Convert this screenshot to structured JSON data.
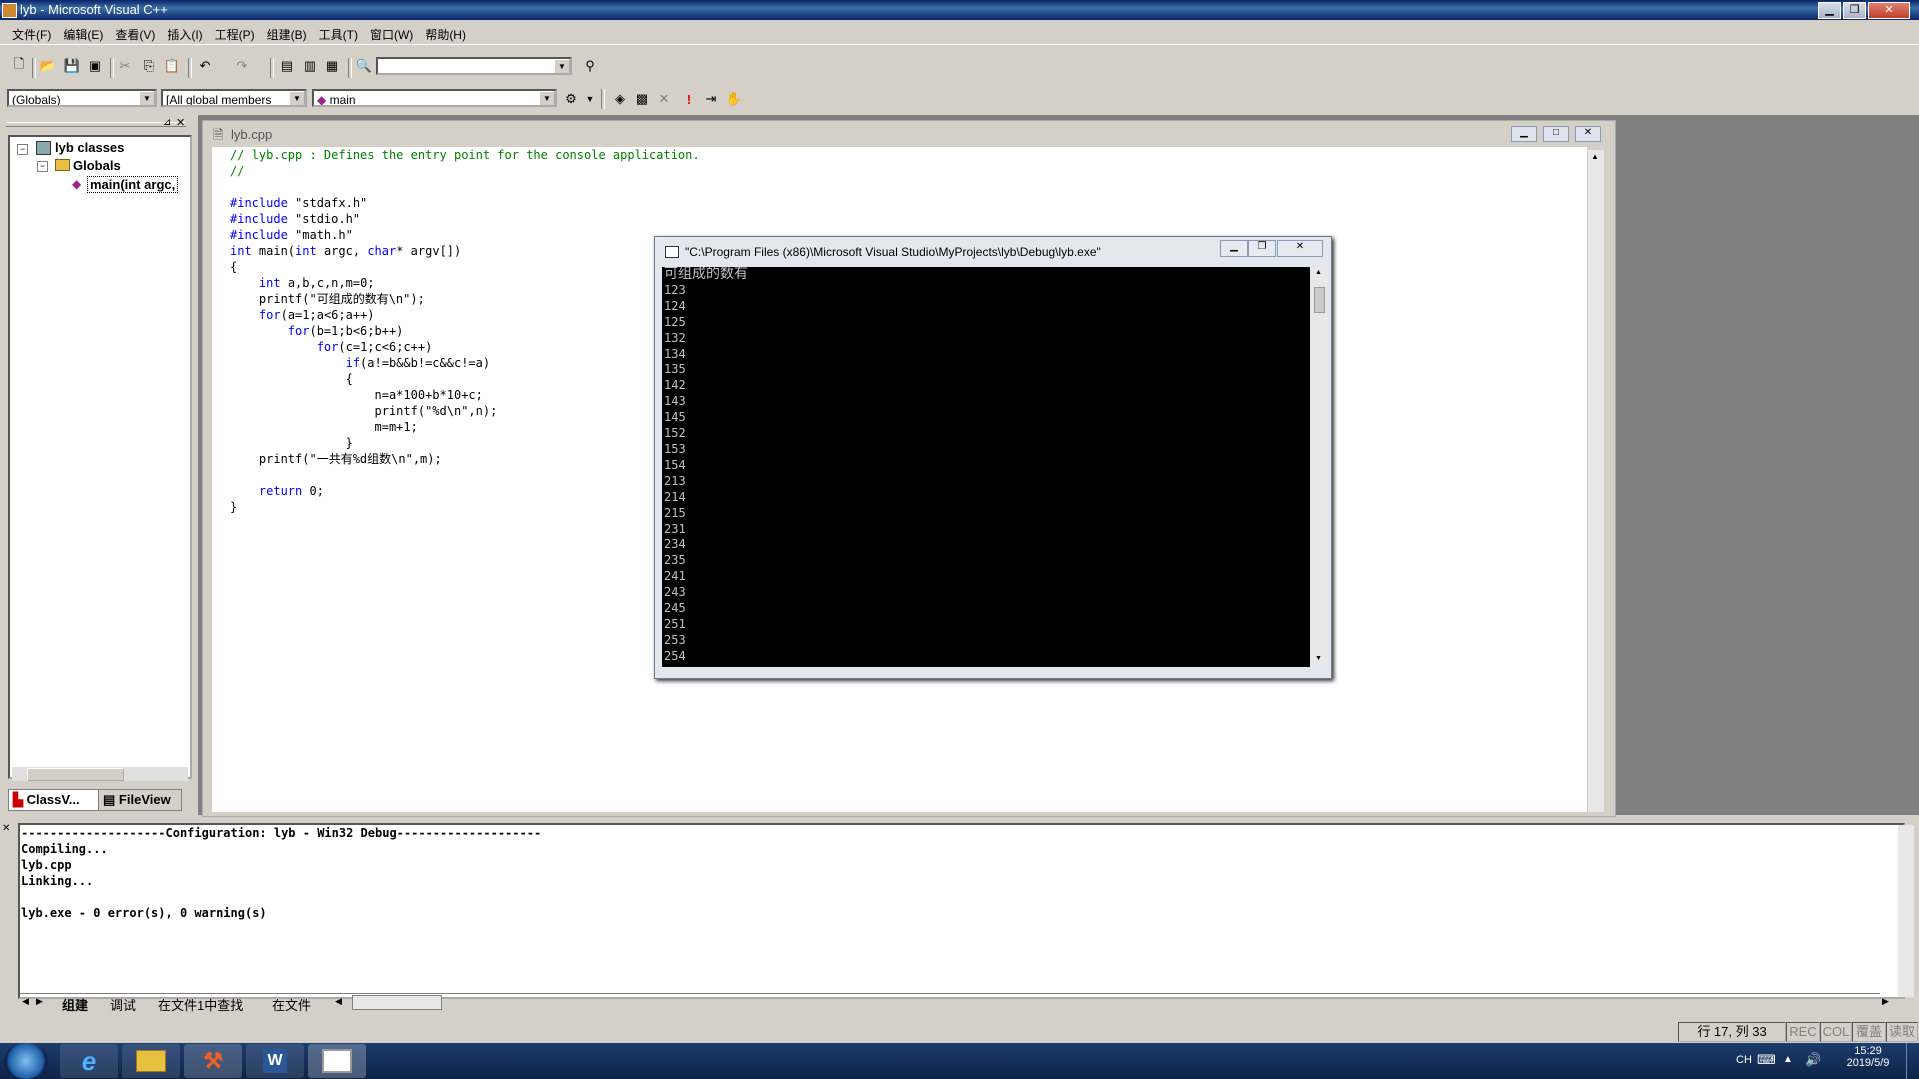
{
  "window": {
    "title": "lyb - Microsoft Visual C++"
  },
  "menu": [
    "文件(F)",
    "编辑(E)",
    "查看(V)",
    "插入(I)",
    "工程(P)",
    "组建(B)",
    "工具(T)",
    "窗口(W)",
    "帮助(H)"
  ],
  "wizard": {
    "class_combo": "(Globals)",
    "filter_combo": "[All global members",
    "member_combo": "main"
  },
  "classview": {
    "root": "lyb classes",
    "folder": "Globals",
    "item": "main(int argc,",
    "tabs": [
      "ClassV...",
      "FileView"
    ]
  },
  "editor": {
    "title": "lyb.cpp",
    "lines": [
      {
        "t": "// lyb.cpp : Defines the entry point for the console application.",
        "c": "c"
      },
      {
        "t": "//",
        "c": "c"
      },
      {
        "t": "",
        "c": ""
      },
      {
        "t": "#include \"stdafx.h\"",
        "c": "inc"
      },
      {
        "t": "#include \"stdio.h\"",
        "c": "inc"
      },
      {
        "t": "#include \"math.h\"",
        "c": "inc"
      },
      {
        "t": "int main(int argc, char* argv[])",
        "c": "sig"
      },
      {
        "t": "{",
        "c": ""
      },
      {
        "t": "    int a,b,c,n,m=0;",
        "c": "kw"
      },
      {
        "t": "    printf(\"可组成的数有\\n\");",
        "c": ""
      },
      {
        "t": "    for(a=1;a<6;a++)",
        "c": "kw"
      },
      {
        "t": "        for(b=1;b<6;b++)",
        "c": "kw"
      },
      {
        "t": "            for(c=1;c<6;c++)",
        "c": "kw"
      },
      {
        "t": "                if(a!=b&&b!=c&&c!=a)",
        "c": "kw"
      },
      {
        "t": "                {",
        "c": ""
      },
      {
        "t": "                    n=a*100+b*10+c;",
        "c": ""
      },
      {
        "t": "                    printf(\"%d\\n\",n);",
        "c": ""
      },
      {
        "t": "                    m=m+1;",
        "c": ""
      },
      {
        "t": "                }",
        "c": ""
      },
      {
        "t": "    printf(\"一共有%d组数\\n\",m);",
        "c": ""
      },
      {
        "t": "",
        "c": ""
      },
      {
        "t": "    return 0;",
        "c": "kw"
      },
      {
        "t": "}",
        "c": ""
      }
    ]
  },
  "console": {
    "title": "\"C:\\Program Files (x86)\\Microsoft Visual Studio\\MyProjects\\lyb\\Debug\\lyb.exe\"",
    "heading": "可组成的数有",
    "numbers": [
      "123",
      "124",
      "125",
      "132",
      "134",
      "135",
      "142",
      "143",
      "145",
      "152",
      "153",
      "154",
      "213",
      "214",
      "215",
      "231",
      "234",
      "235",
      "241",
      "243",
      "245",
      "251",
      "253",
      "254"
    ]
  },
  "output": {
    "lines": [
      "--------------------Configuration: lyb - Win32 Debug--------------------",
      "Compiling...",
      "lyb.cpp",
      "Linking...",
      "",
      "lyb.exe - 0 error(s), 0 warning(s)"
    ],
    "tabs": [
      "组建",
      "调试",
      "在文件1中查找",
      "在文件"
    ]
  },
  "status": {
    "position": "行 17, 列 33",
    "rec": "REC",
    "col": "COL",
    "ovr": "覆盖",
    "read": "读取"
  },
  "taskbar": {
    "time": "15:29",
    "date": "2019/5/9",
    "lang": "CH"
  }
}
